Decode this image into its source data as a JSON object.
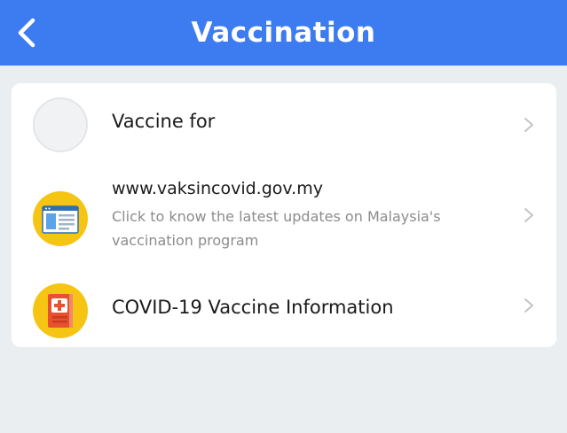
{
  "header": {
    "title": "Vaccination",
    "back_icon": "chevron-left-icon",
    "background": "#3d7cf0"
  },
  "items": [
    {
      "label": "Vaccine for",
      "icon": "empty-avatar"
    },
    {
      "title": "www.vaksincovid.gov.my",
      "subtitle": "Click to know the latest updates on Malaysia's vaccination program",
      "icon": "webpage-icon"
    },
    {
      "label": "COVID-19 Vaccine Information",
      "icon": "medical-book-icon"
    }
  ],
  "colors": {
    "accent": "#f6c514",
    "background": "#ebeef0"
  }
}
